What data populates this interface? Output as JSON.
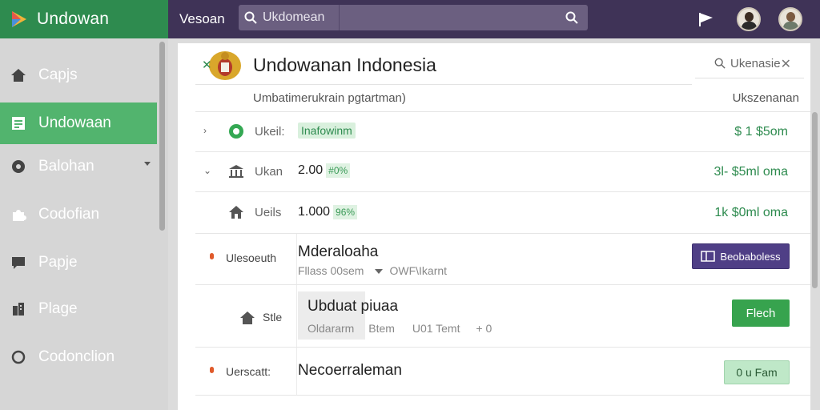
{
  "brand": {
    "name": "Undowan"
  },
  "topbar": {
    "title": "Vesoan",
    "search_value": "Ukdomean"
  },
  "sidebar": {
    "items": [
      {
        "label": "Capjs",
        "icon": "home-icon"
      },
      {
        "label": "Undowaan",
        "icon": "list-icon",
        "active": true
      },
      {
        "label": "Balohan",
        "icon": "settings-icon",
        "expandable": true
      },
      {
        "label": "Codofian",
        "icon": "puzzle-icon"
      },
      {
        "label": "Papje",
        "icon": "chat-icon"
      },
      {
        "label": "Plage",
        "icon": "building-icon"
      },
      {
        "label": "Codonclion",
        "icon": "globe-icon"
      }
    ]
  },
  "main": {
    "title": "Undowanan Indonesia",
    "right_search": "Ukenasie",
    "subhead_left": "Umbatimerukrain pgtartman)",
    "subhead_right": "Ukszenanan",
    "rows": [
      {
        "label": "Ukeil:",
        "tag": "Inafowinm",
        "amount": "$ 1 $5om"
      },
      {
        "label": "Ukan",
        "value": "2.00",
        "pct": "#0%",
        "amount": "3l- $5ml oma"
      },
      {
        "label": "Ueils",
        "value": "1.000",
        "pct": "96%",
        "amount": "1k $0ml oma"
      }
    ],
    "details": [
      {
        "label": "Ulesoeuth",
        "title": "Mderaloaha",
        "meta1": "Fllass 00sem",
        "meta2": "OWF\\Ikarnt",
        "button": "Beobaboless"
      },
      {
        "label": "Stle",
        "title": "Ubduat piuaa",
        "meta1": "Oldararm",
        "meta2": "Btem",
        "meta3": "U01 Temt",
        "meta4": "+ 0",
        "button": "Flech"
      },
      {
        "label": "Uerscatt:",
        "title": "Necoerraleman",
        "button": "0 u Fam"
      }
    ]
  },
  "colors": {
    "brand_green": "#2e8b4f",
    "topbar_purple": "#3f3357",
    "active_green": "#52b46e",
    "purple_button": "#4f3f86",
    "green_button": "#37a34e"
  }
}
